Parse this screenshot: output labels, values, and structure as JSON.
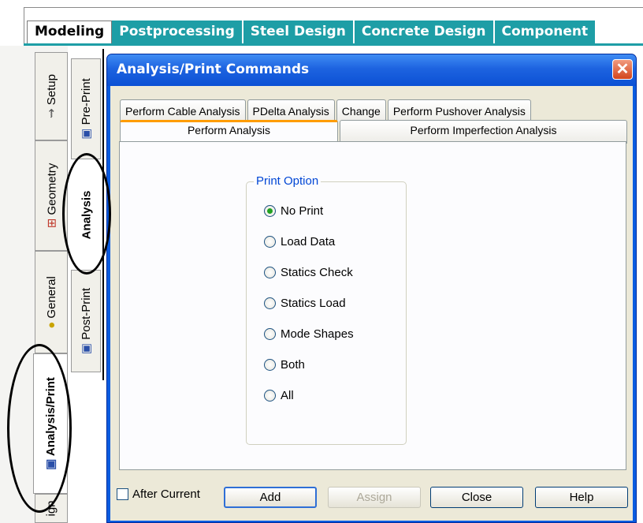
{
  "mode_tabs": [
    "Modeling",
    "Postprocessing",
    "Steel Design",
    "Concrete Design",
    "Component"
  ],
  "left_tabs": {
    "setup": "Setup",
    "geometry": "Geometry",
    "general": "General",
    "analysis_print": "Analysis/Print",
    "design": "ign"
  },
  "sub_tabs": {
    "pre_print": "Pre-Print",
    "analysis": "Analysis",
    "post_print": "Post-Print"
  },
  "dialog": {
    "title": "Analysis/Print Commands",
    "tabs_row1": [
      "Perform Cable Analysis",
      "PDelta Analysis",
      "Change",
      "Perform Pushover Analysis"
    ],
    "tabs_row2": [
      "Perform Analysis",
      "Perform Imperfection Analysis"
    ],
    "print_option": {
      "title": "Print Option",
      "options": [
        "No Print",
        "Load Data",
        "Statics Check",
        "Statics Load",
        "Mode Shapes",
        "Both",
        "All"
      ],
      "selected": "No Print"
    },
    "after_current_label": "After Current",
    "buttons": {
      "add": "Add",
      "assign": "Assign",
      "close": "Close",
      "help": "Help"
    }
  },
  "colors": {
    "accent_teal": "#1e9ea6",
    "xp_blue": "#0a5ce0",
    "selected_radio": "#21a121"
  }
}
